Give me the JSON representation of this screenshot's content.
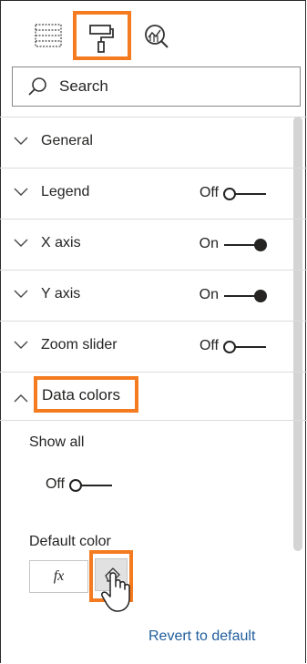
{
  "toolbar": {
    "icons": [
      "fields-icon",
      "paint-roller-icon",
      "analytics-magnifier-icon"
    ],
    "active": "paint-roller-icon",
    "highlight_color": "#f47b20"
  },
  "search": {
    "placeholder": "Search",
    "value": ""
  },
  "sections": {
    "general": {
      "label": "General",
      "expanded": false
    },
    "legend": {
      "label": "Legend",
      "expanded": false,
      "toggle": "Off",
      "on": false
    },
    "xaxis": {
      "label": "X axis",
      "expanded": false,
      "toggle": "On",
      "on": true
    },
    "yaxis": {
      "label": "Y axis",
      "expanded": false,
      "toggle": "On",
      "on": true
    },
    "zoom": {
      "label": "Zoom slider",
      "expanded": false,
      "toggle": "Off",
      "on": false
    },
    "datacolors": {
      "label": "Data colors",
      "expanded": true
    }
  },
  "data_colors": {
    "show_all_label": "Show all",
    "show_all_toggle": "Off",
    "default_color_label": "Default color",
    "fx_label": "fx",
    "revert_label": "Revert to default"
  },
  "colors": {
    "link": "#1f5d9c",
    "text": "#252423",
    "toggle_on": "#252423"
  }
}
